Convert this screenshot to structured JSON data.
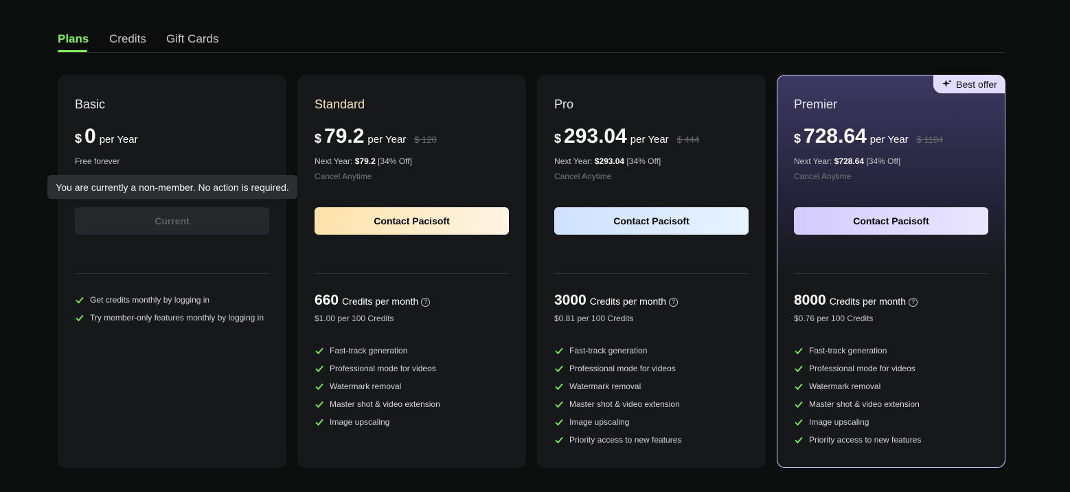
{
  "tabs": [
    {
      "label": "Plans",
      "active": true
    },
    {
      "label": "Credits",
      "active": false
    },
    {
      "label": "Gift Cards",
      "active": false
    }
  ],
  "colors": {
    "accent": "#7df05c",
    "background": "#0c0d0d",
    "card": "#17181a"
  },
  "tooltip": "You are currently a non-member. No action is required.",
  "plans": [
    {
      "name": "Basic",
      "currency": "$",
      "amount": "0",
      "period": "per Year",
      "note": "Free forever",
      "button": "Current",
      "features": [
        "Get credits monthly by logging in",
        "Try member-only features monthly by logging in"
      ]
    },
    {
      "name": "Standard",
      "currency": "$",
      "amount": "79.2",
      "period": "per Year",
      "old_price": "$ 120",
      "next_label": "Next Year:",
      "next_price": "$79.2",
      "next_discount": "[34% Off]",
      "cancel": "Cancel Anytime",
      "button": "Contact Pacisoft",
      "credits": "660",
      "credits_label": "Credits per month",
      "credits_price": "$1.00 per 100 Credits",
      "features": [
        "Fast-track generation",
        "Professional mode for videos",
        "Watermark removal",
        "Master shot & video extension",
        "Image upscaling"
      ]
    },
    {
      "name": "Pro",
      "currency": "$",
      "amount": "293.04",
      "period": "per Year",
      "old_price": "$ 444",
      "next_label": "Next Year:",
      "next_price": "$293.04",
      "next_discount": "[34% Off]",
      "cancel": "Cancel Anytime",
      "button": "Contact Pacisoft",
      "credits": "3000",
      "credits_label": "Credits per month",
      "credits_price": "$0.81 per 100 Credits",
      "features": [
        "Fast-track generation",
        "Professional mode for videos",
        "Watermark removal",
        "Master shot & video extension",
        "Image upscaling",
        "Priority access to new features"
      ]
    },
    {
      "name": "Premier",
      "badge": "Best offer",
      "currency": "$",
      "amount": "728.64",
      "period": "per Year",
      "old_price": "$ 1104",
      "next_label": "Next Year:",
      "next_price": "$728.64",
      "next_discount": "[34% Off]",
      "cancel": "Cancel Anytime",
      "button": "Contact Pacisoft",
      "credits": "8000",
      "credits_label": "Credits per month",
      "credits_price": "$0.76 per 100 Credits",
      "features": [
        "Fast-track generation",
        "Professional mode for videos",
        "Watermark removal",
        "Master shot & video extension",
        "Image upscaling",
        "Priority access to new features"
      ]
    }
  ]
}
